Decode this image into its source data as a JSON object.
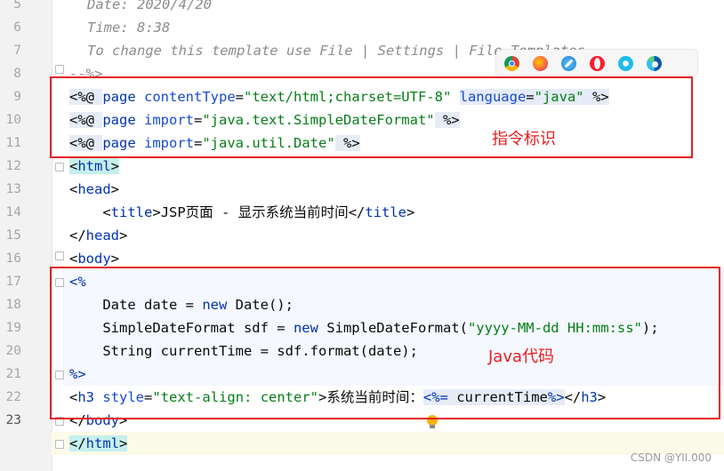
{
  "editor": {
    "line_numbers": [
      "5",
      "6",
      "7",
      "8",
      "9",
      "10",
      "11",
      "12",
      "13",
      "14",
      "15",
      "16",
      "17",
      "18",
      "19",
      "20",
      "21",
      "22",
      "23"
    ],
    "current_line": "23",
    "comment_lines": {
      "date": "Date: 2020/4/20",
      "time": "Time: 8:38",
      "template": "To change this template use File | Settings | File Templates."
    },
    "line7": "--%>",
    "line8": {
      "open": "<%@ ",
      "page": "page",
      "sp1": " ",
      "attr1": "contentType",
      "eq1": "=",
      "val1": "\"text/html;charset=UTF-8\"",
      "sp2": " ",
      "attr2": "language",
      "eq2": "=",
      "val2": "\"java\"",
      "close": " %>"
    },
    "line9": {
      "open": "<%@ ",
      "page": "page",
      "sp": " ",
      "attr": "import",
      "eq": "=",
      "val": "\"java.text.SimpleDateFormat\"",
      "close": " %>"
    },
    "line10": {
      "open": "<%@ ",
      "page": "page",
      "sp": " ",
      "attr": "import",
      "eq": "=",
      "val": "\"java.util.Date\"",
      "close": " %>"
    },
    "line11": {
      "lt": "<",
      "tag": "html",
      "gt": ">"
    },
    "line12": {
      "lt": "<",
      "tag": "head",
      "gt": ">"
    },
    "line13": {
      "indent": "    ",
      "lt": "<",
      "tag": "title",
      "gt": ">",
      "text": "JSP页面 - 显示系统当前时间",
      "lt2": "</",
      "tag2": "title",
      "gt2": ">"
    },
    "line14": {
      "lt": "</",
      "tag": "head",
      "gt": ">"
    },
    "line15": {
      "lt": "<",
      "tag": "body",
      "gt": ">"
    },
    "line16": "<%",
    "line17": {
      "indent": "    ",
      "pre": "Date date = ",
      "kw": "new",
      "post": " Date();"
    },
    "line18": {
      "indent": "    ",
      "pre": "SimpleDateFormat sdf = ",
      "kw": "new",
      "mid": " SimpleDateFormat(",
      "str": "\"yyyy-MM-dd HH:mm:ss\"",
      "post": ");"
    },
    "line19": "    String currentTime = sdf.format(date);",
    "line20": "%>",
    "line21": {
      "lt": "<",
      "tag": "h3",
      "sp": " ",
      "attr": "style",
      "eq": "=",
      "val": "\"text-align: center\"",
      "gt": ">",
      "text": "系统当前时间：",
      "expr_open": "<%=",
      "expr": " currentTime",
      "expr_close": "%>",
      "lt2": "</",
      "tag2": "h3",
      "gt2": ">"
    },
    "line22": {
      "lt": "</",
      "tag": "body",
      "gt": ">"
    },
    "line23": {
      "lt": "</",
      "tag": "html",
      "gt": ">"
    }
  },
  "annotations": {
    "directive_label": "指令标识",
    "java_label": "Java代码",
    "color": "#e81d1d"
  },
  "browser_icons": [
    "chrome-icon",
    "firefox-icon",
    "safari-icon",
    "opera-icon",
    "ie-icon",
    "edge-icon"
  ],
  "watermark": "CSDN @YII.000"
}
